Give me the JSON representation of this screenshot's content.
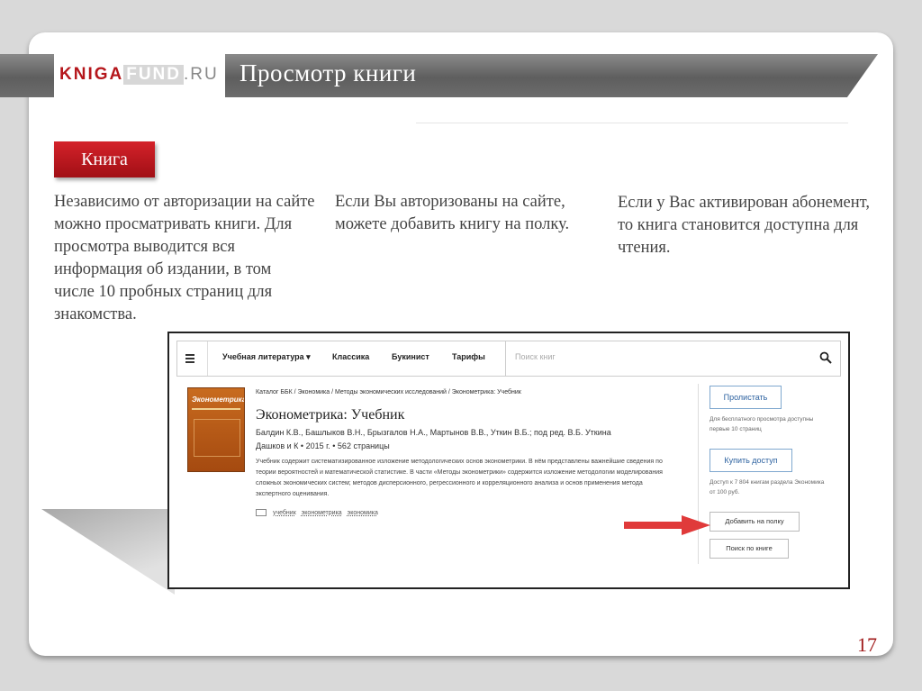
{
  "slide": {
    "logo_part1": "KNIGA",
    "logo_part2": "FUND",
    "logo_part3": ".RU",
    "title": "Просмотр книги",
    "badge": "Книга",
    "col1": "Независимо от авторизации на сайте можно просматривать книги. Для просмотра выводится вся информация об издании, в том числе 10 пробных страниц для знакомства.",
    "col2": "Если Вы авторизованы на сайте, можете добавить книгу на полку.",
    "col3": "Если у Вас активирован абонемент, то книга становится доступна для чтения.",
    "page_number": "17"
  },
  "site": {
    "nav": {
      "items": [
        "Учебная литература ▾",
        "Классика",
        "Букинист",
        "Тарифы"
      ],
      "search_placeholder": "Поиск книг"
    },
    "book": {
      "cover_title": "Эконометрика",
      "breadcrumb": "Каталог ББК / Экономика / Методы экономических исследований / Эконометрика: Учебник",
      "title": "Эконометрика: Учебник",
      "authors": "Балдин К.В., Башлыков В.Н., Брызгалов Н.А., Мартынов В.В., Уткин В.Б.; под ред. В.Б. Уткина",
      "meta": "Дашков и К  •  2015 г.  •  562 страницы",
      "description": "Учебник содержит систематизированное изложение методологических основ эконометрики. В нём представлены важнейшие сведения по теории вероятностей и математической статистике. В части «Методы эконометрики» содержится изложение методологии моделирования сложных экономических систем; методов дисперсионного, регрессионного и корреляционного анализа и основ применения метода экспертного оценивания.",
      "tags": [
        "учебник",
        "эконометрика",
        "экономика"
      ]
    },
    "actions": {
      "scroll_label": "Пролистать",
      "scroll_note": "Для бесплатного просмотра доступны первые 10 страниц",
      "buy_label": "Купить доступ",
      "buy_note": "Доступ к 7 804 книгам раздела Экономика от 100 руб.",
      "shelf_label": "Добавить на полку",
      "search_label": "Поиск по книге"
    }
  },
  "colors": {
    "brand_red": "#b5161b",
    "band_gray": "#6b6b6b",
    "arrow_red": "#e03a3a",
    "link_blue": "#2d62a0"
  }
}
